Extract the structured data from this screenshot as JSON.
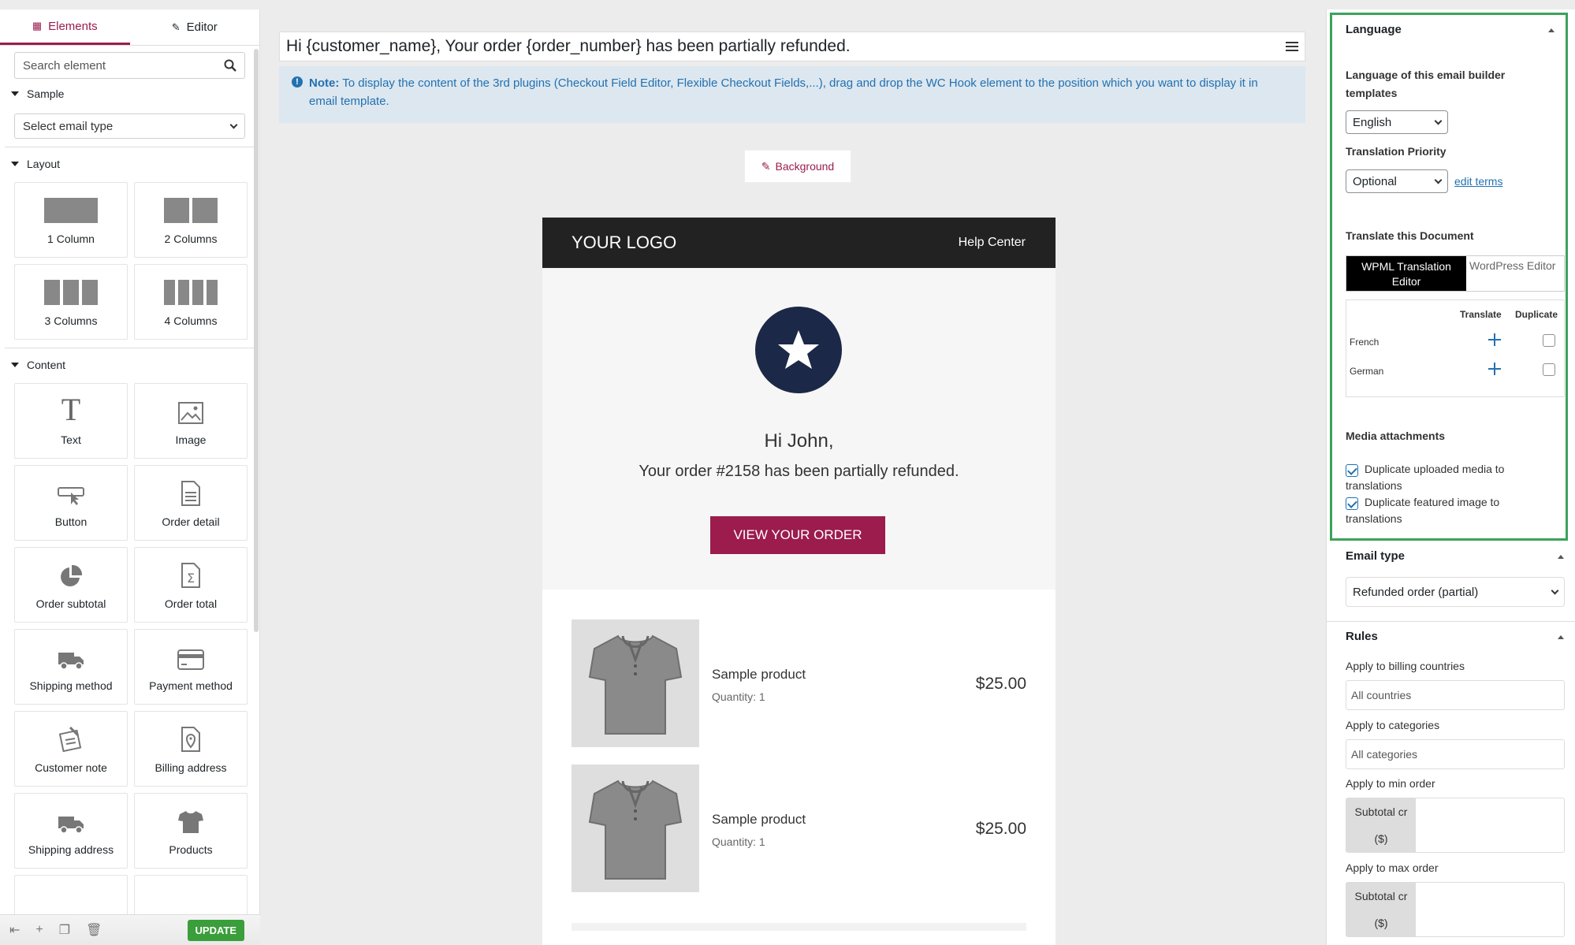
{
  "sidebar": {
    "tabs": [
      {
        "label": "Elements",
        "icon": "grid-icon"
      },
      {
        "label": "Editor",
        "icon": "pencil-icon"
      }
    ],
    "search_placeholder": "Search element",
    "sections": {
      "sample": "Sample",
      "layout": "Layout",
      "content": "Content"
    },
    "email_type_select": "Select email type",
    "layout_items": [
      "1 Column",
      "2 Columns",
      "3 Columns",
      "4 Columns"
    ],
    "content_items": [
      {
        "label": "Text",
        "icon": "text-icon"
      },
      {
        "label": "Image",
        "icon": "image-icon"
      },
      {
        "label": "Button",
        "icon": "button-icon"
      },
      {
        "label": "Order detail",
        "icon": "document-icon"
      },
      {
        "label": "Order subtotal",
        "icon": "pie-chart-icon"
      },
      {
        "label": "Order total",
        "icon": "sigma-icon"
      },
      {
        "label": "Shipping method",
        "icon": "truck-icon"
      },
      {
        "label": "Payment method",
        "icon": "credit-card-icon"
      },
      {
        "label": "Customer note",
        "icon": "note-icon"
      },
      {
        "label": "Billing address",
        "icon": "location-icon"
      },
      {
        "label": "Shipping address",
        "icon": "truck-icon"
      },
      {
        "label": "Products",
        "icon": "tshirt-icon"
      }
    ],
    "update_label": "UPDATE"
  },
  "canvas": {
    "subject": "Hi {customer_name}, Your order {order_number} has been partially refunded.",
    "note_label": "Note:",
    "note_text": " To display the content of the 3rd plugins (Checkout Field Editor, Flexible Checkout Fields,...), drag and drop the WC Hook element to the position which you want to display it in email template.",
    "background_label": "Background",
    "email": {
      "logo": "YOUR LOGO",
      "help": "Help Center",
      "greeting": "Hi John,",
      "message": "Your order #2158 has been partially refunded.",
      "button": "VIEW YOUR ORDER",
      "products": [
        {
          "name": "Sample product",
          "qty": "Quantity: 1",
          "price": "$25.00"
        },
        {
          "name": "Sample product",
          "qty": "Quantity: 1",
          "price": "$25.00"
        }
      ]
    }
  },
  "panel": {
    "language": {
      "title": "Language",
      "lang_label": "Language of this email builder templates",
      "lang_value": "English",
      "priority_label": "Translation Priority",
      "priority_value": "Optional",
      "edit_terms": "edit terms",
      "translate_doc": "Translate this Document",
      "seg_wpml": "WPML Translation Editor",
      "seg_wp": "WordPress Editor",
      "col_translate": "Translate",
      "col_duplicate": "Duplicate",
      "languages": [
        "French",
        "German"
      ],
      "media_title": "Media attachments",
      "media_opt1": "Duplicate uploaded media to translations",
      "media_opt2": "Duplicate featured image to translations"
    },
    "email_type": {
      "title": "Email type",
      "value": "Refunded order (partial)"
    },
    "rules": {
      "title": "Rules",
      "billing_label": "Apply to billing countries",
      "billing_value": "All countries",
      "categories_label": "Apply to categories",
      "categories_value": "All categories",
      "min_label": "Apply to min order",
      "max_label": "Apply to max order",
      "subtotal_line1": "Subtotal cr",
      "subtotal_line2": "($)"
    }
  },
  "colors": {
    "accent": "#9b1c4d",
    "link": "#2271b1",
    "highlight_border": "#3aa35a",
    "update": "#3a9e3a"
  }
}
